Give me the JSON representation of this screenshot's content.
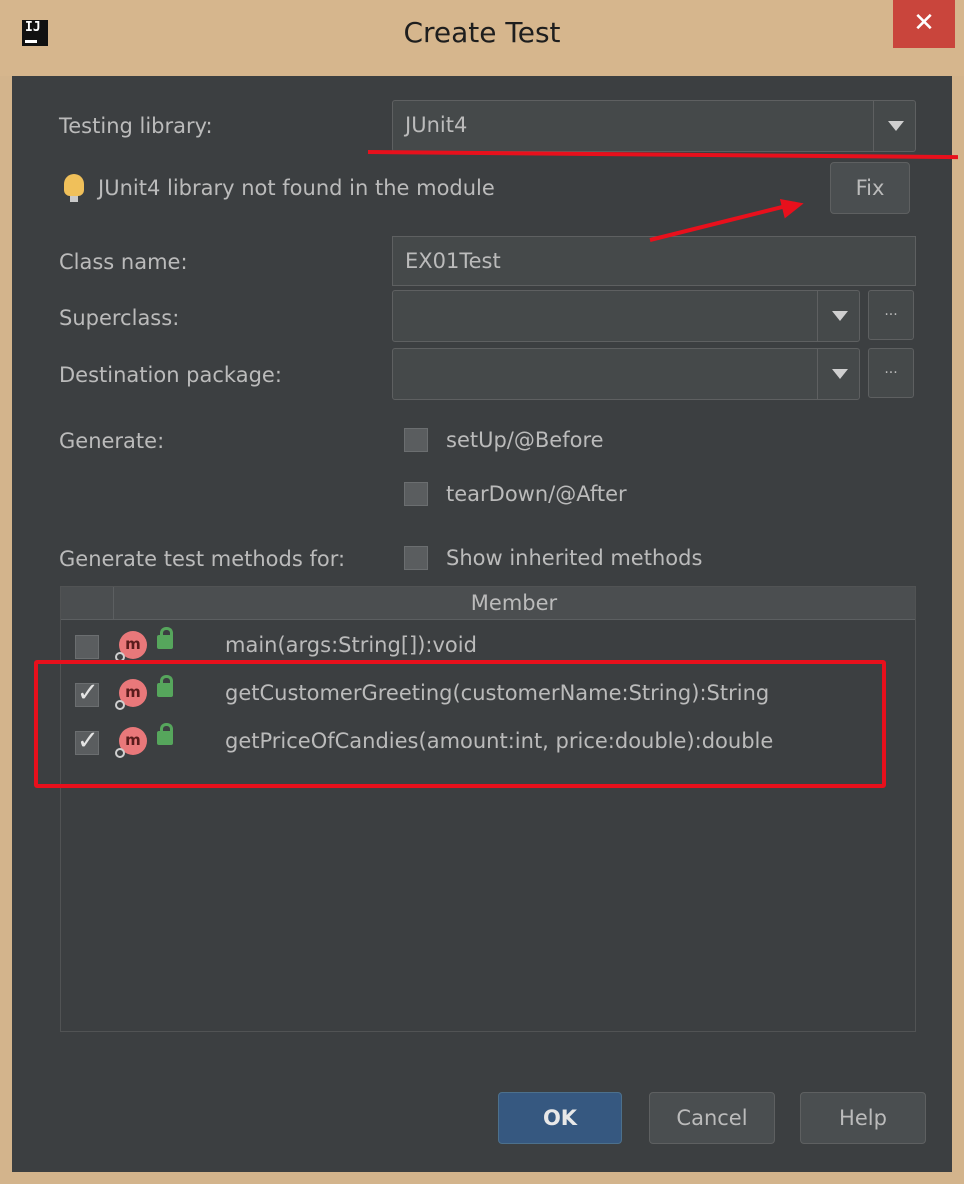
{
  "window": {
    "title": "Create Test",
    "app_logo": "IJ",
    "close_glyph": "✕"
  },
  "form": {
    "testing_library_label": "Testing library:",
    "testing_library_value": "JUnit4",
    "warning_text": "JUnit4 library not found in the module",
    "fix_label": "Fix",
    "class_name_label": "Class name:",
    "class_name_value": "EX01Test",
    "superclass_label": "Superclass:",
    "superclass_value": "",
    "destination_label": "Destination package:",
    "destination_value": "",
    "browse_glyph": "...",
    "generate_label": "Generate:",
    "setup_label": "setUp/@Before",
    "setup_checked": false,
    "teardown_label": "tearDown/@After",
    "teardown_checked": false,
    "methods_label": "Generate test methods for:",
    "inherited_label": "Show inherited methods",
    "inherited_checked": false
  },
  "table": {
    "header": "Member",
    "rows": [
      {
        "signature": "main(args:String[]):void",
        "checked": false,
        "icon": "method-icon",
        "access": "public-lock-icon"
      },
      {
        "signature": "getCustomerGreeting(customerName:String):String",
        "checked": true,
        "icon": "method-icon",
        "access": "public-lock-icon"
      },
      {
        "signature": "getPriceOfCandies(amount:int, price:double):double",
        "checked": true,
        "icon": "method-icon",
        "access": "public-lock-icon"
      }
    ]
  },
  "buttons": {
    "ok": "OK",
    "cancel": "Cancel",
    "help": "Help"
  },
  "colors": {
    "dialog_bg": "#3c3f41",
    "title_bg": "#d6b68d",
    "close_bg": "#c9453c",
    "primary_button": "#365880",
    "annotation_red": "#e8101c"
  }
}
